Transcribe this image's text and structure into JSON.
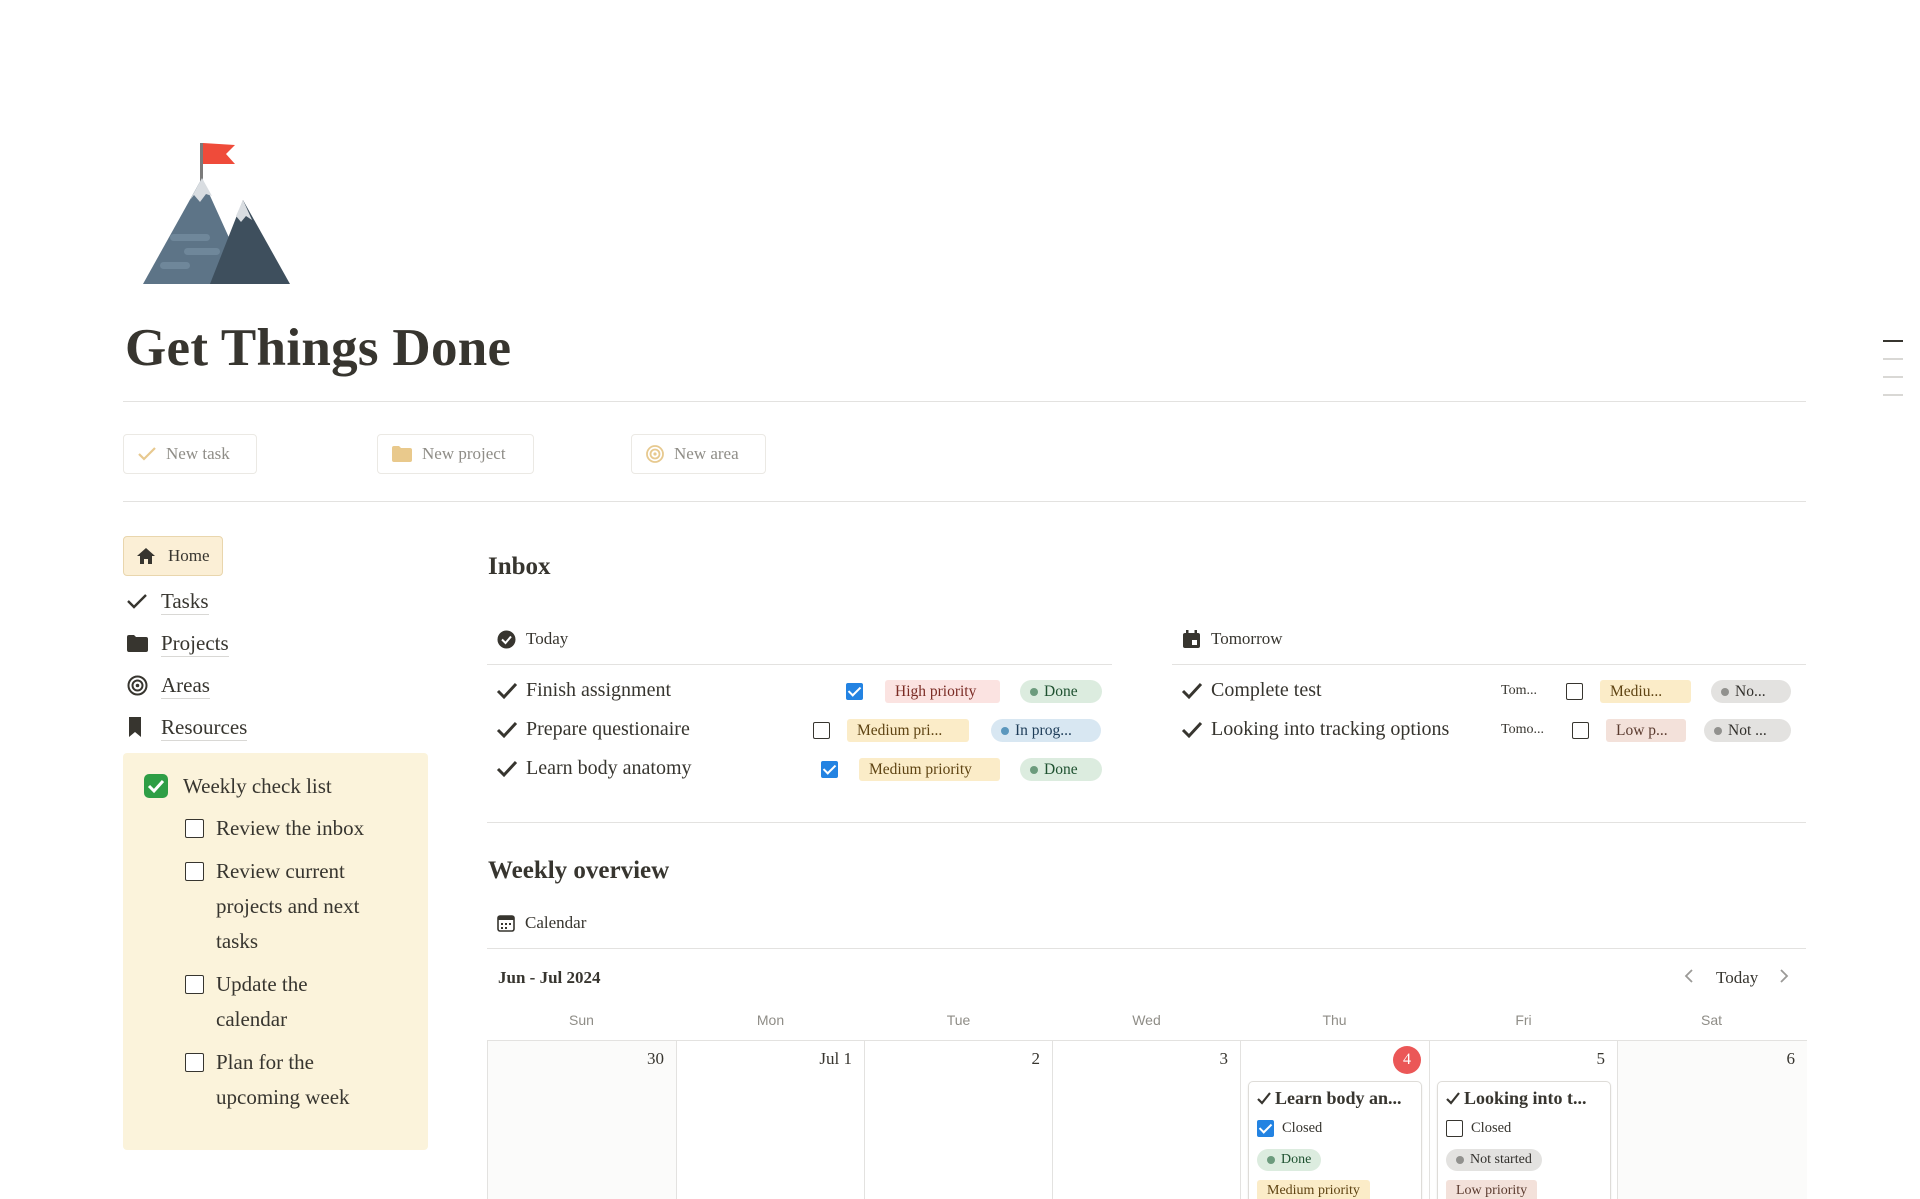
{
  "page": {
    "title": "Get Things Done"
  },
  "actions": {
    "new_task": "New task",
    "new_project": "New project",
    "new_area": "New area"
  },
  "sidebar": {
    "home": "Home",
    "items": [
      {
        "label": "Tasks",
        "icon": "check-icon"
      },
      {
        "label": "Projects",
        "icon": "folder-icon"
      },
      {
        "label": "Areas",
        "icon": "target-icon"
      },
      {
        "label": "Resources",
        "icon": "bookmark-icon"
      }
    ]
  },
  "checklist": {
    "title": "Weekly check list",
    "items": [
      "Review the inbox",
      "Review current projects and next tasks",
      "Update the calendar",
      "Plan for the upcoming week"
    ]
  },
  "inbox": {
    "title": "Inbox",
    "today": {
      "label": "Today",
      "rows": [
        {
          "name": "Finish assignment",
          "closed": true,
          "priority": "High priority",
          "status": "Done"
        },
        {
          "name": "Prepare questionaire",
          "closed": false,
          "priority": "Medium pri...",
          "status": "In prog..."
        },
        {
          "name": "Learn body anatomy",
          "closed": true,
          "priority": "Medium priority",
          "status": "Done"
        }
      ]
    },
    "tomorrow": {
      "label": "Tomorrow",
      "rows": [
        {
          "name": "Complete test",
          "date": "Tom...",
          "closed": false,
          "priority": "Mediu...",
          "status": "No..."
        },
        {
          "name": "Looking into tracking options",
          "date": "Tomo...",
          "closed": false,
          "priority": "Low p...",
          "status": "Not ..."
        }
      ]
    }
  },
  "weekly": {
    "title": "Weekly overview",
    "view": "Calendar",
    "range": "Jun - Jul 2024",
    "today_btn": "Today",
    "days": [
      "Sun",
      "Mon",
      "Tue",
      "Wed",
      "Thu",
      "Fri",
      "Sat"
    ],
    "dates": [
      "30",
      "Jul 1",
      "2",
      "3",
      "4",
      "5",
      "6"
    ],
    "today_index": 4,
    "cards": {
      "thu": {
        "title": "Learn body an...",
        "closed_label": "Closed",
        "closed": true,
        "status": "Done",
        "priority": "Medium priority"
      },
      "fri": {
        "title": "Looking into t...",
        "closed_label": "Closed",
        "closed": false,
        "status": "Not started",
        "priority": "Low priority"
      }
    }
  },
  "colors": {
    "accent": "#2383e2",
    "today": "#eb5757",
    "checklist_bg": "#fbf3db",
    "home_bg": "#fbefd6"
  }
}
